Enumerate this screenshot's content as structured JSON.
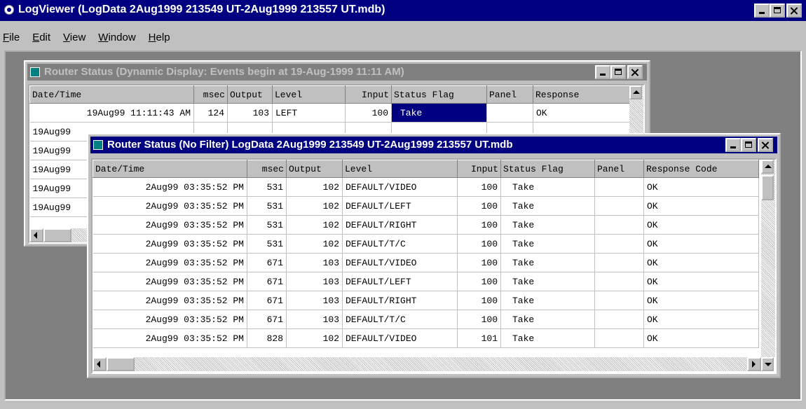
{
  "app": {
    "title": "LogViewer (LogData 2Aug1999 213549 UT-2Aug1999 213557 UT.mdb)"
  },
  "menu": {
    "items": [
      {
        "mnemonic": "F",
        "rest": "ile"
      },
      {
        "mnemonic": "E",
        "rest": "dit"
      },
      {
        "mnemonic": "V",
        "rest": "iew"
      },
      {
        "mnemonic": "W",
        "rest": "indow"
      },
      {
        "mnemonic": "H",
        "rest": "elp"
      }
    ]
  },
  "win_dynamic": {
    "title": "Router Status (Dynamic Display: Events begin at 19-Aug-1999 11:11 AM)",
    "columns": [
      "Date/Time",
      "msec",
      "Output",
      "Level",
      "Input",
      "Status Flag",
      "Panel",
      "Response"
    ],
    "first_row": [
      "19Aug99 11:11:43 AM",
      "124",
      "103",
      "LEFT",
      "100",
      "Take",
      "",
      "OK"
    ],
    "partial_rows": [
      "19Aug99",
      "19Aug99",
      "19Aug99",
      "19Aug99",
      "19Aug99"
    ]
  },
  "win_nofilter": {
    "title": "Router Status (No Filter) LogData 2Aug1999 213549 UT-2Aug1999 213557 UT.mdb",
    "columns": [
      "Date/Time",
      "msec",
      "Output",
      "Level",
      "Input",
      "Status Flag",
      "Panel",
      "Response Code"
    ],
    "rows": [
      [
        "2Aug99 03:35:52 PM",
        "531",
        "102",
        "DEFAULT/VIDEO",
        "100",
        "Take",
        "",
        "OK"
      ],
      [
        "2Aug99 03:35:52 PM",
        "531",
        "102",
        "DEFAULT/LEFT",
        "100",
        "Take",
        "",
        "OK"
      ],
      [
        "2Aug99 03:35:52 PM",
        "531",
        "102",
        "DEFAULT/RIGHT",
        "100",
        "Take",
        "",
        "OK"
      ],
      [
        "2Aug99 03:35:52 PM",
        "531",
        "102",
        "DEFAULT/T/C",
        "100",
        "Take",
        "",
        "OK"
      ],
      [
        "2Aug99 03:35:52 PM",
        "671",
        "103",
        "DEFAULT/VIDEO",
        "100",
        "Take",
        "",
        "OK"
      ],
      [
        "2Aug99 03:35:52 PM",
        "671",
        "103",
        "DEFAULT/LEFT",
        "100",
        "Take",
        "",
        "OK"
      ],
      [
        "2Aug99 03:35:52 PM",
        "671",
        "103",
        "DEFAULT/RIGHT",
        "100",
        "Take",
        "",
        "OK"
      ],
      [
        "2Aug99 03:35:52 PM",
        "671",
        "103",
        "DEFAULT/T/C",
        "100",
        "Take",
        "",
        "OK"
      ],
      [
        "2Aug99 03:35:52 PM",
        "828",
        "102",
        "DEFAULT/VIDEO",
        "101",
        "Take",
        "",
        "OK"
      ]
    ]
  }
}
